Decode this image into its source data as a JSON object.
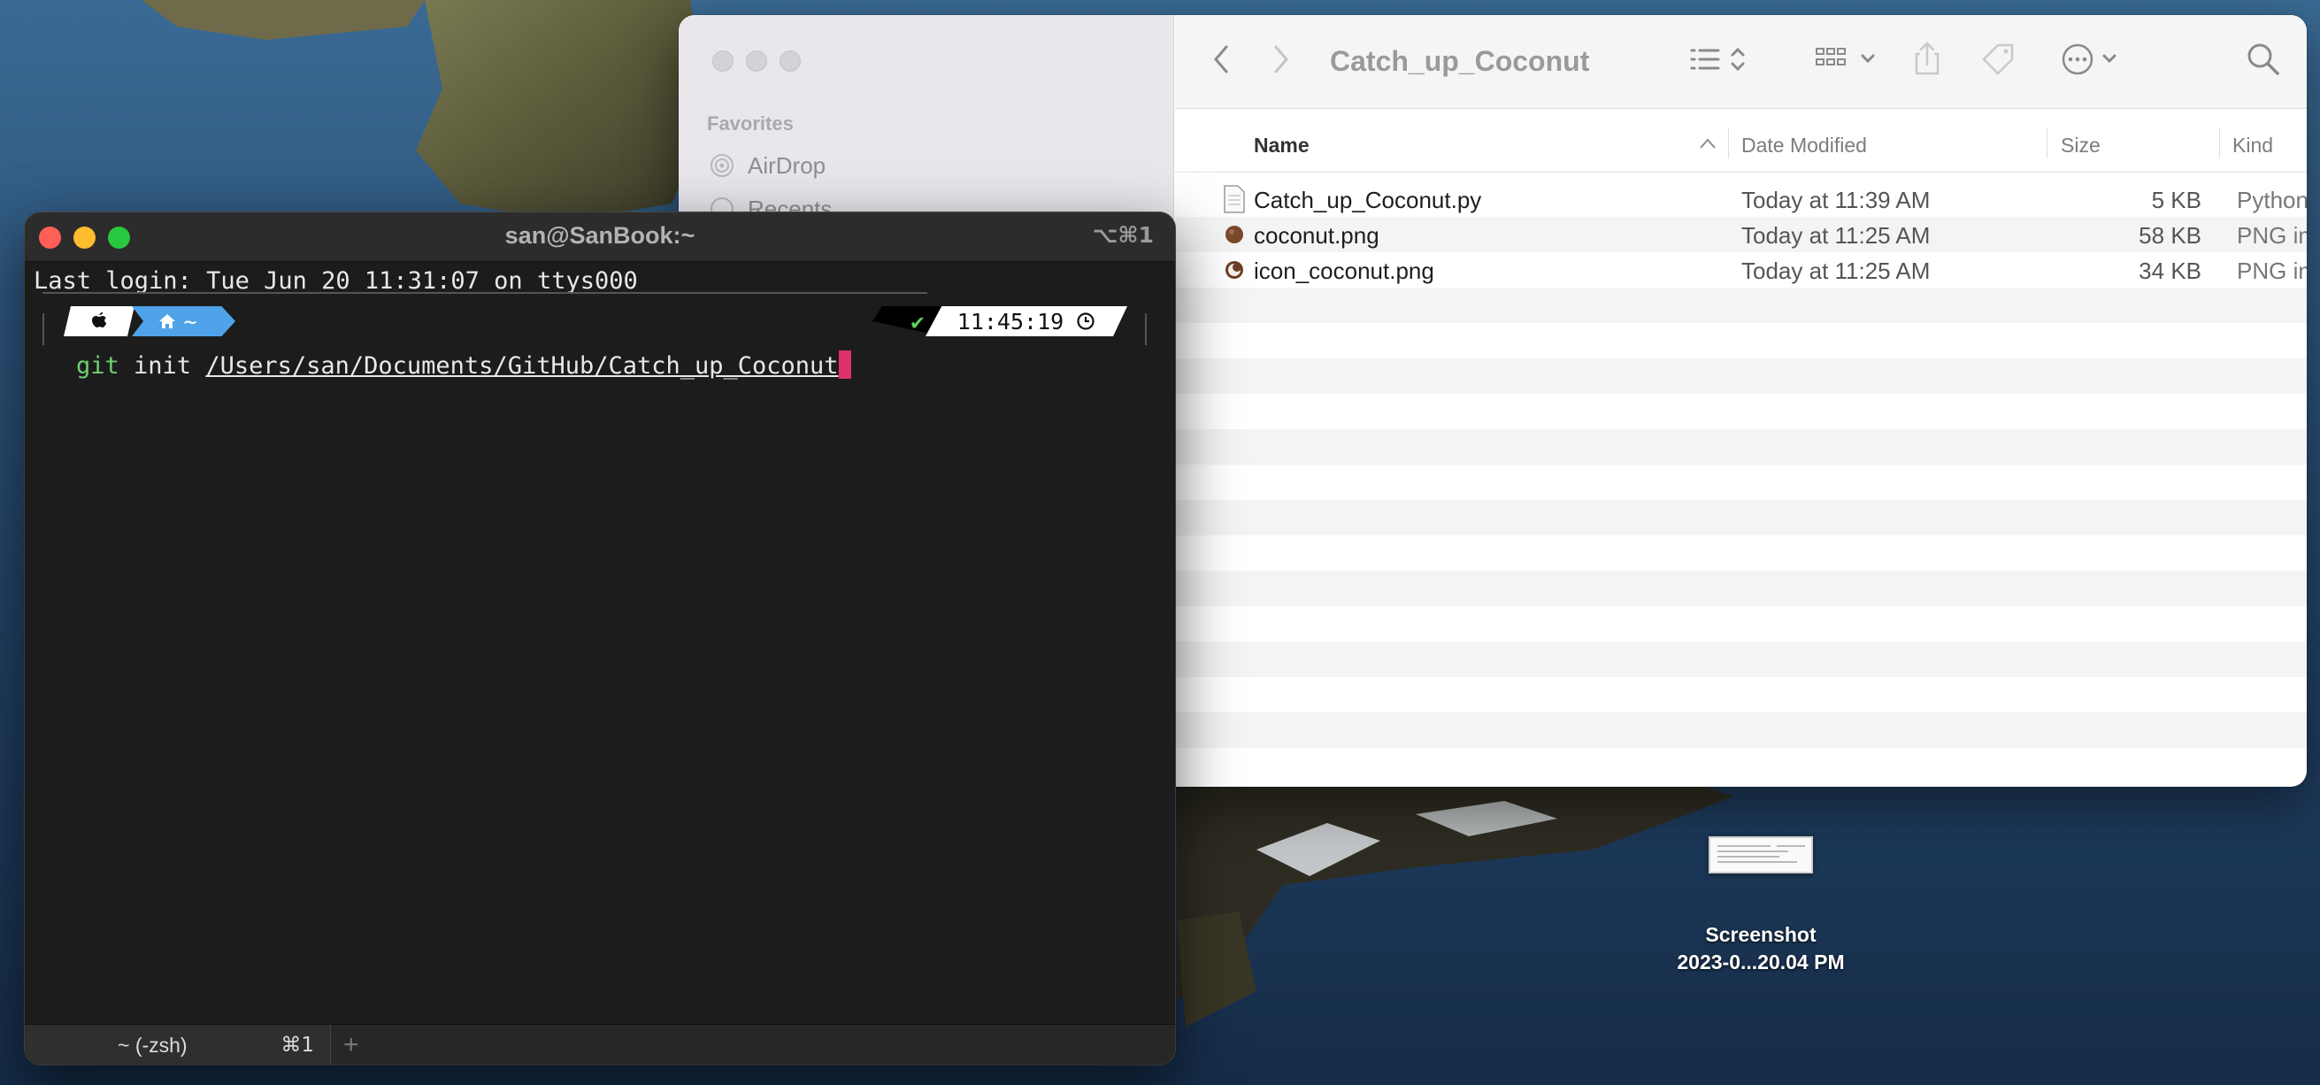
{
  "finder": {
    "title": "Catch_up_Coconut",
    "sidebar": {
      "section": "Favorites",
      "items": [
        {
          "label": "AirDrop",
          "icon": "airdrop-icon"
        },
        {
          "label": "Recents",
          "icon": "clock-icon"
        }
      ]
    },
    "columns": {
      "name": "Name",
      "date": "Date Modified",
      "size": "Size",
      "kind": "Kind"
    },
    "files": [
      {
        "name": "Catch_up_Coconut.py",
        "date": "Today at 11:39 AM",
        "size": "5 KB",
        "kind": "Python",
        "icon": "python-file-icon"
      },
      {
        "name": "coconut.png",
        "date": "Today at 11:25 AM",
        "size": "58 KB",
        "kind": "PNG image",
        "icon": "coconut-image-icon"
      },
      {
        "name": "icon_coconut.png",
        "date": "Today at 11:25 AM",
        "size": "34 KB",
        "kind": "PNG image",
        "icon": "coconut-half-image-icon"
      }
    ]
  },
  "terminal": {
    "title": "san@SanBook:~",
    "shortcut": "⌥⌘1",
    "last_login": "Last login: Tue Jun 20 11:31:07 on ttys000",
    "prompt": {
      "home": "~",
      "status": "✔",
      "time": "11:45:19"
    },
    "command": {
      "program": "git",
      "args": " init ",
      "path": "/Users/san/Documents/GitHub/Catch_up_Coconut"
    },
    "tab": {
      "label": "~ (-zsh)",
      "shortcut": "⌘1",
      "add": "+"
    }
  },
  "desktop": {
    "icon_label_line1": "Screenshot",
    "icon_label_line2": "2023-0...20.04 PM"
  },
  "colors": {
    "cursor": "#e0306a",
    "prompt_home": "#4fa3e8",
    "git_green": "#6fcf6f"
  }
}
